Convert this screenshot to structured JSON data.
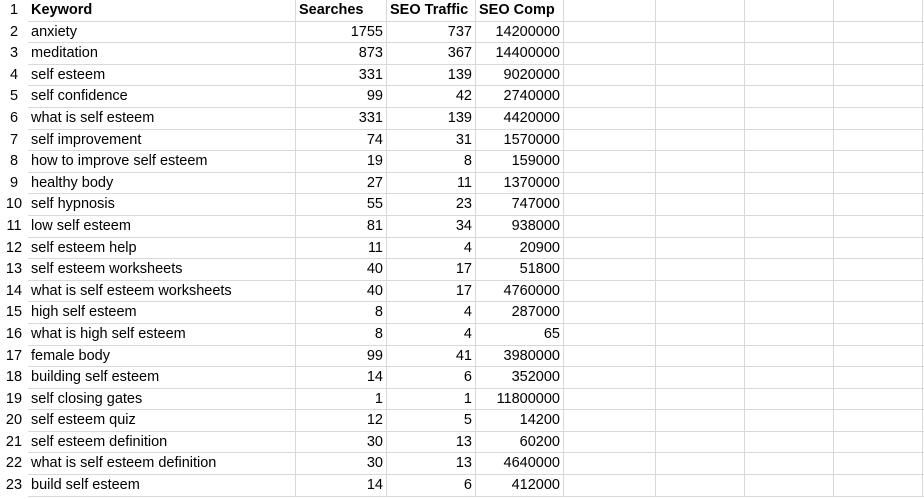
{
  "headers": {
    "row": "1",
    "keyword": "Keyword",
    "searches": "Searches",
    "seo_traffic": "SEO Traffic",
    "seo_comp": "SEO Comp"
  },
  "rows": [
    {
      "n": "2",
      "keyword": "anxiety",
      "searches": "1755",
      "traffic": "737",
      "comp": "14200000"
    },
    {
      "n": "3",
      "keyword": "meditation",
      "searches": "873",
      "traffic": "367",
      "comp": "14400000"
    },
    {
      "n": "4",
      "keyword": "self esteem",
      "searches": "331",
      "traffic": "139",
      "comp": "9020000"
    },
    {
      "n": "5",
      "keyword": "self confidence",
      "searches": "99",
      "traffic": "42",
      "comp": "2740000"
    },
    {
      "n": "6",
      "keyword": "what is self esteem",
      "searches": "331",
      "traffic": "139",
      "comp": "4420000"
    },
    {
      "n": "7",
      "keyword": "self improvement",
      "searches": "74",
      "traffic": "31",
      "comp": "1570000"
    },
    {
      "n": "8",
      "keyword": "how to improve self esteem",
      "searches": "19",
      "traffic": "8",
      "comp": "159000"
    },
    {
      "n": "9",
      "keyword": "healthy body",
      "searches": "27",
      "traffic": "11",
      "comp": "1370000"
    },
    {
      "n": "10",
      "keyword": "self hypnosis",
      "searches": "55",
      "traffic": "23",
      "comp": "747000"
    },
    {
      "n": "11",
      "keyword": "low self esteem",
      "searches": "81",
      "traffic": "34",
      "comp": "938000"
    },
    {
      "n": "12",
      "keyword": "self esteem help",
      "searches": "11",
      "traffic": "4",
      "comp": "20900"
    },
    {
      "n": "13",
      "keyword": "self esteem worksheets",
      "searches": "40",
      "traffic": "17",
      "comp": "51800"
    },
    {
      "n": "14",
      "keyword": "what is self esteem worksheets",
      "searches": "40",
      "traffic": "17",
      "comp": "4760000"
    },
    {
      "n": "15",
      "keyword": "high self esteem",
      "searches": "8",
      "traffic": "4",
      "comp": "287000"
    },
    {
      "n": "16",
      "keyword": "what is high self esteem",
      "searches": "8",
      "traffic": "4",
      "comp": "65"
    },
    {
      "n": "17",
      "keyword": "female body",
      "searches": "99",
      "traffic": "41",
      "comp": "3980000"
    },
    {
      "n": "18",
      "keyword": "building self esteem",
      "searches": "14",
      "traffic": "6",
      "comp": "352000"
    },
    {
      "n": "19",
      "keyword": "self closing gates",
      "searches": "1",
      "traffic": "1",
      "comp": "11800000"
    },
    {
      "n": "20",
      "keyword": "self esteem quiz",
      "searches": "12",
      "traffic": "5",
      "comp": "14200"
    },
    {
      "n": "21",
      "keyword": "self esteem definition",
      "searches": "30",
      "traffic": "13",
      "comp": "60200"
    },
    {
      "n": "22",
      "keyword": "what is self esteem definition",
      "searches": "30",
      "traffic": "13",
      "comp": "4640000"
    },
    {
      "n": "23",
      "keyword": "build self esteem",
      "searches": "14",
      "traffic": "6",
      "comp": "412000"
    }
  ]
}
